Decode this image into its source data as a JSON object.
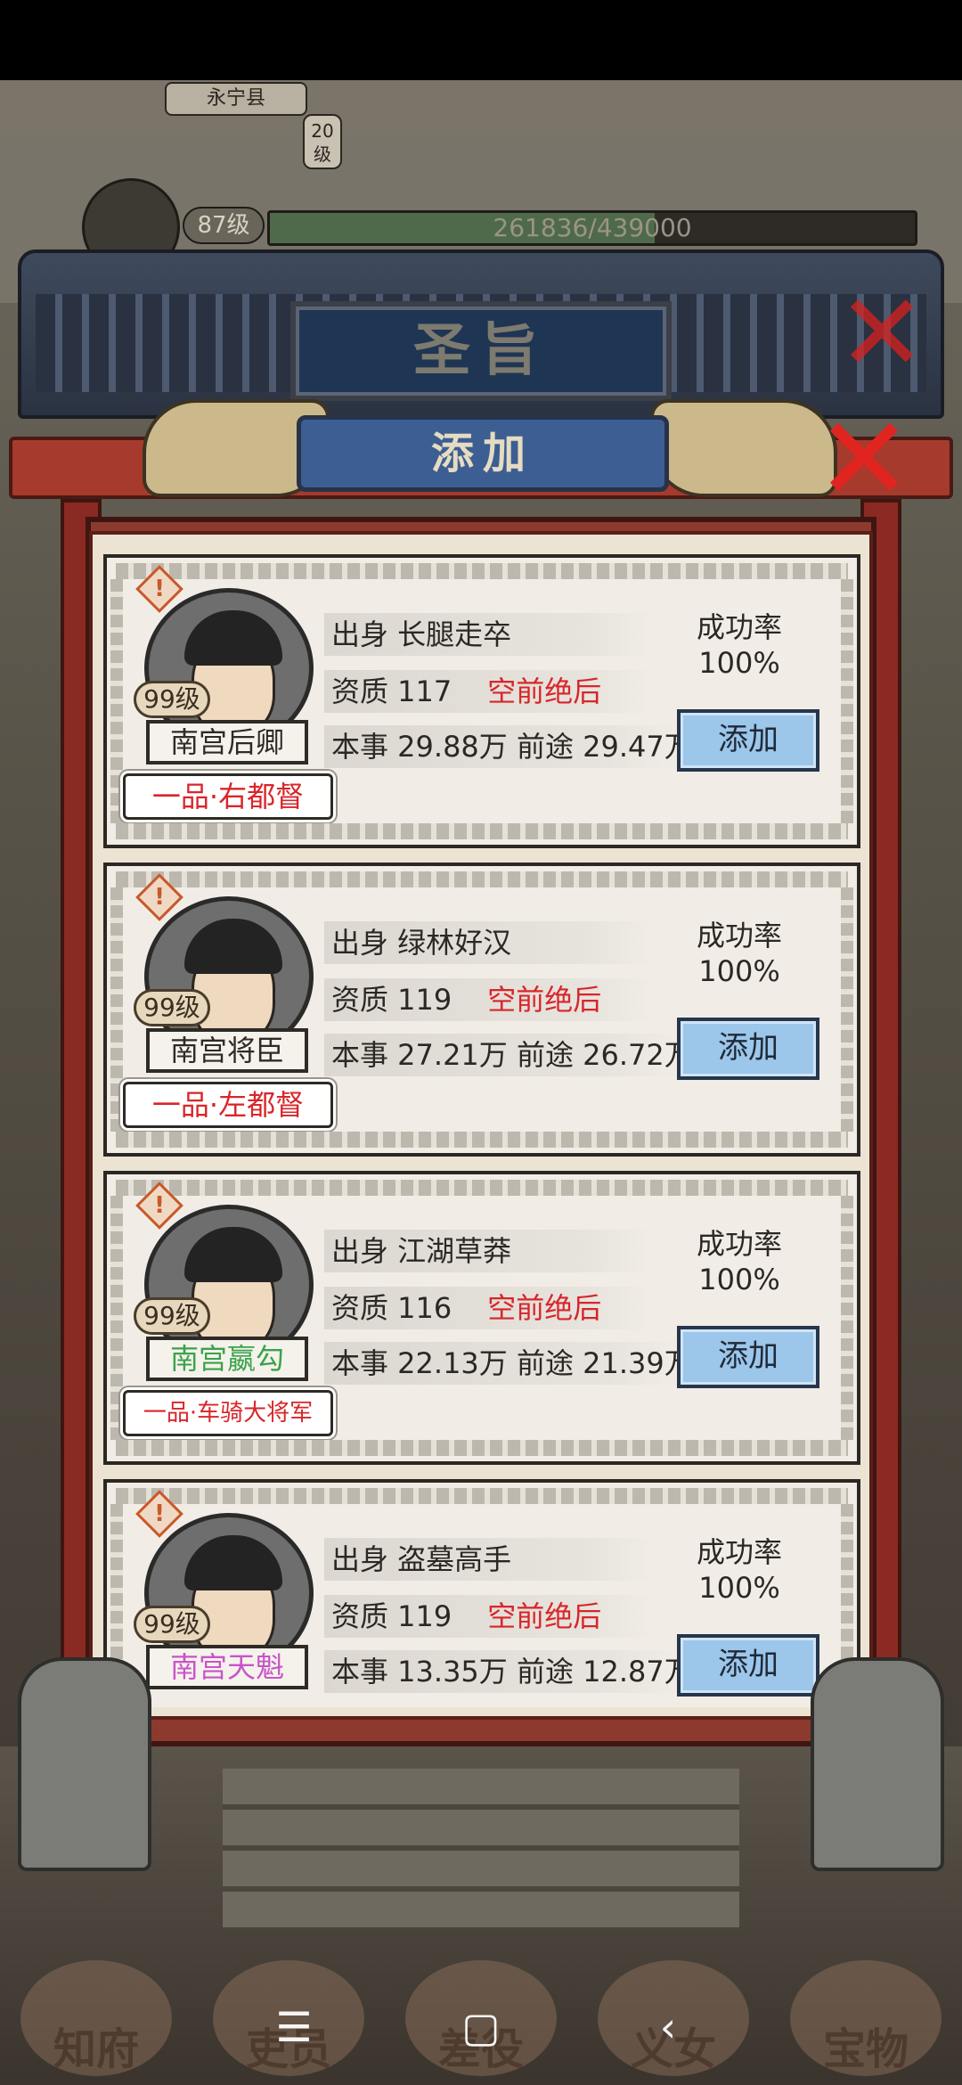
{
  "map": {
    "county": "永宁县",
    "county_level": "20级"
  },
  "player": {
    "level": "87级",
    "exp_text": "261836/439000",
    "exp_fraction": 0.596
  },
  "dialog": {
    "title": "圣旨",
    "tab_label": "添加",
    "close_glyph": "✕"
  },
  "labels": {
    "origin": "出身",
    "aptitude": "资质",
    "skill": "本事",
    "prospect": "前途",
    "success_rate": "成功率",
    "add_button": "添加",
    "warning": "!"
  },
  "candidates": [
    {
      "level": "99级",
      "name": "南宫后卿",
      "name_color": "#2e2a25",
      "rank": "一品·右都督",
      "stat1": "出身 长腿走卒",
      "aptitude_text": "资质 117",
      "tag": "空前绝后",
      "stat3": "本事 29.88万 前途 29.47万",
      "success_label": "成功率",
      "success_value": "100%",
      "button": "添加"
    },
    {
      "level": "99级",
      "name": "南宫将臣",
      "name_color": "#2e2a25",
      "rank": "一品·左都督",
      "stat1": "出身 绿林好汉",
      "aptitude_text": "资质 119",
      "tag": "空前绝后",
      "stat3": "本事 27.21万 前途 26.72万",
      "success_label": "成功率",
      "success_value": "100%",
      "button": "添加"
    },
    {
      "level": "99级",
      "name": "南宫嬴勾",
      "name_color": "#3aa34a",
      "rank": "一品·车骑大将军",
      "stat1": "出身 江湖草莽",
      "aptitude_text": "资质 116",
      "tag": "空前绝后",
      "stat3": "本事 22.13万 前途 21.39万",
      "success_label": "成功率",
      "success_value": "100%",
      "button": "添加"
    },
    {
      "level": "99级",
      "name": "南宫天魁",
      "name_color": "#c855c8",
      "rank": "",
      "stat1": "出身 盗墓高手",
      "aptitude_text": "资质 119",
      "tag": "空前绝后",
      "stat3": "本事 13.35万 前途 12.87万",
      "success_label": "成功率",
      "success_value": "100%",
      "button": "添加"
    }
  ],
  "bottom_nav": [
    "知府",
    "吏员",
    "差役",
    "义女",
    "宝物"
  ],
  "system_nav": {
    "menu": "☰",
    "home": "▢",
    "back": "‹"
  }
}
